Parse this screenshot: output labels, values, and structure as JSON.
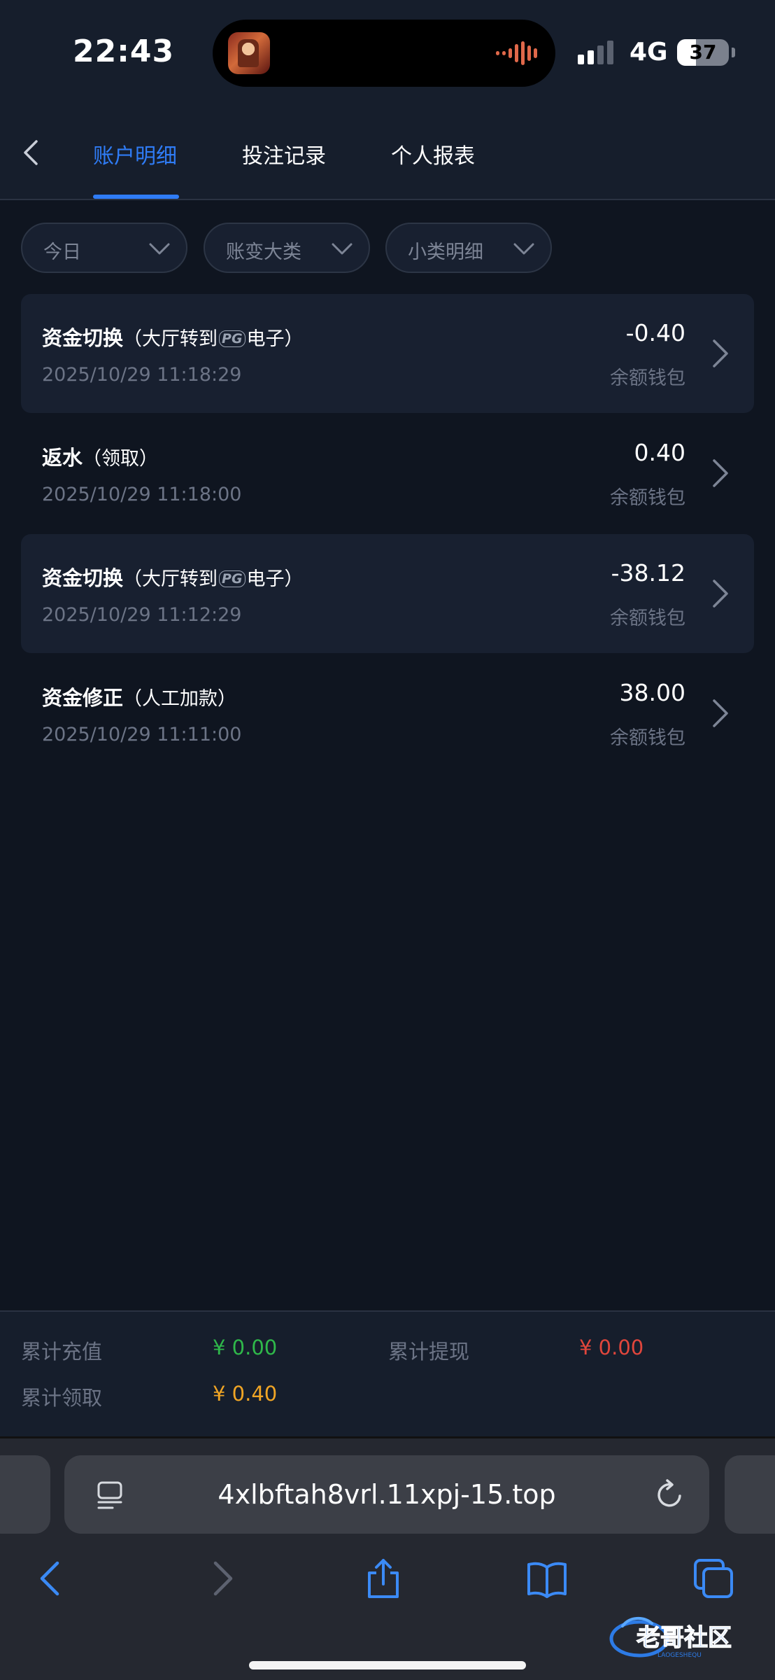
{
  "status_bar": {
    "time": "22:43",
    "network": "4G",
    "battery": "37",
    "battery_level": 0.37,
    "icons": [
      "signal-bars-icon",
      "battery-icon"
    ]
  },
  "nav": {
    "tabs": [
      {
        "label": "账户明细",
        "active": true
      },
      {
        "label": "投注记录",
        "active": false
      },
      {
        "label": "个人报表",
        "active": false
      }
    ]
  },
  "filters": [
    {
      "label": "今日"
    },
    {
      "label": "账变大类"
    },
    {
      "label": "小类明细"
    }
  ],
  "transactions": [
    {
      "title": "资金切换",
      "sub_before": "（大厅转到",
      "logo": "PG",
      "sub_after": "电子）",
      "date": "2025/10/29 11:18:29",
      "amount": "-0.40",
      "wallet": "余额钱包"
    },
    {
      "title": "返水",
      "sub_before": "（领取）",
      "logo": "",
      "sub_after": "",
      "date": "2025/10/29 11:18:00",
      "amount": "0.40",
      "wallet": "余额钱包"
    },
    {
      "title": "资金切换",
      "sub_before": "（大厅转到",
      "logo": "PG",
      "sub_after": "电子）",
      "date": "2025/10/29 11:12:29",
      "amount": "-38.12",
      "wallet": "余额钱包"
    },
    {
      "title": "资金修正",
      "sub_before": "（人工加款）",
      "logo": "",
      "sub_after": "",
      "date": "2025/10/29 11:11:00",
      "amount": "38.00",
      "wallet": "余额钱包"
    }
  ],
  "summary": {
    "recharge_label": "累计充值",
    "recharge_value": "¥ 0.00",
    "withdraw_label": "累计提现",
    "withdraw_value": "¥ 0.00",
    "claim_label": "累计领取",
    "claim_value": "¥ 0.40",
    "colors": {
      "recharge": "#2fb84a",
      "withdraw": "#e0463c",
      "claim": "#f0a525"
    }
  },
  "browser": {
    "url": "4xlbftah8vrl.11xpj-15.top",
    "watermark_text": "老哥社区",
    "watermark_sub": "LAOGESHEQU"
  },
  "colors": {
    "accent": "#2f7cf6",
    "background": "#0f1520",
    "panel": "#161e2c"
  }
}
